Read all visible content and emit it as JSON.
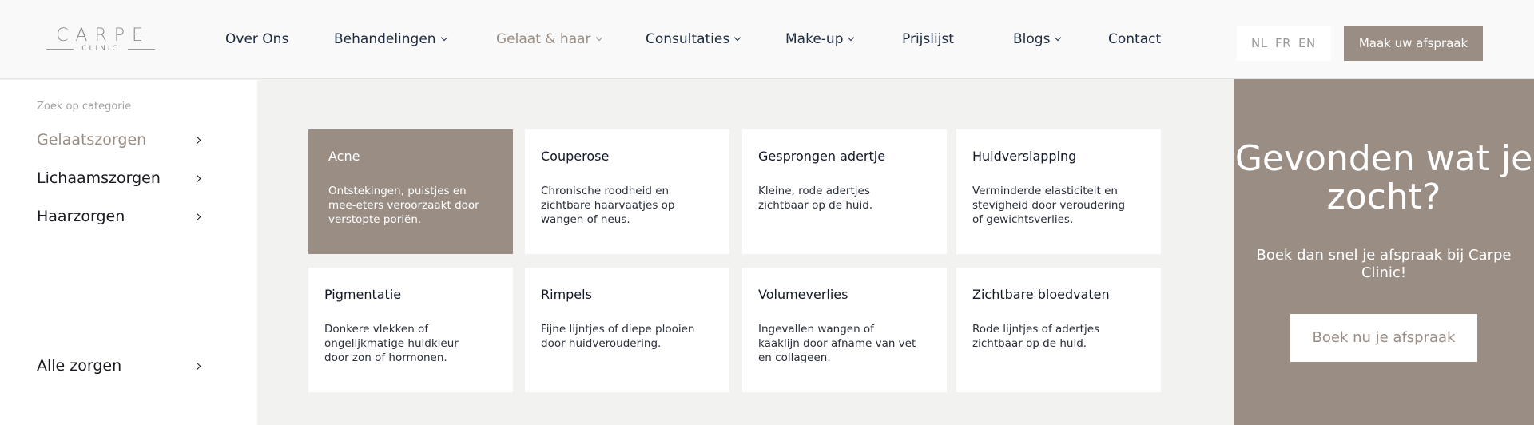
{
  "logo": {
    "main": "CARPE",
    "sub": "CLINIC"
  },
  "nav": {
    "items": [
      {
        "label": "Over Ons"
      },
      {
        "label": "Behandelingen"
      },
      {
        "label": "Gelaat & haar"
      },
      {
        "label": "Consultaties"
      },
      {
        "label": "Make-up"
      },
      {
        "label": "Prijslijst"
      },
      {
        "label": "Blogs"
      },
      {
        "label": "Contact"
      }
    ],
    "languages": [
      "NL",
      "FR",
      "EN"
    ],
    "cta": "Maak uw afspraak"
  },
  "sidebar": {
    "heading": "Zoek op categorie",
    "items": [
      {
        "label": "Gelaatszorgen"
      },
      {
        "label": "Lichaamszorgen"
      },
      {
        "label": "Haarzorgen"
      }
    ],
    "all": "Alle zorgen"
  },
  "cards": [
    {
      "title": "Acne",
      "desc": "Ontstekingen, puistjes en mee-eters veroorzaakt door verstopte poriën."
    },
    {
      "title": "Couperose",
      "desc": "Chronische roodheid en zichtbare haarvaatjes op wangen of neus."
    },
    {
      "title": "Gesprongen adertje",
      "desc": "Kleine, rode adertjes zichtbaar op de huid."
    },
    {
      "title": "Huidverslapping",
      "desc": "Verminderde elasticiteit en stevigheid door veroudering of gewichtsverlies."
    },
    {
      "title": "Pigmentatie",
      "desc": "Donkere vlekken of ongelijkmatige huidkleur door zon of hormonen."
    },
    {
      "title": "Rimpels",
      "desc": "Fijne lijntjes of diepe plooien door huidveroudering."
    },
    {
      "title": "Volumeverlies",
      "desc": "Ingevallen wangen of kaaklijn door afname van vet en collageen."
    },
    {
      "title": "Zichtbare bloedvaten",
      "desc": "Rode lijntjes of adertjes zichtbaar op de huid."
    }
  ],
  "promo": {
    "title": "Gevonden wat je zocht?",
    "subtitle": "Boek dan snel je afspraak bij Carpe Clinic!",
    "button": "Boek nu je afspraak"
  },
  "colors": {
    "accent": "#9a8d84",
    "text": "#1e2b40",
    "background": "#f2f2f1"
  }
}
